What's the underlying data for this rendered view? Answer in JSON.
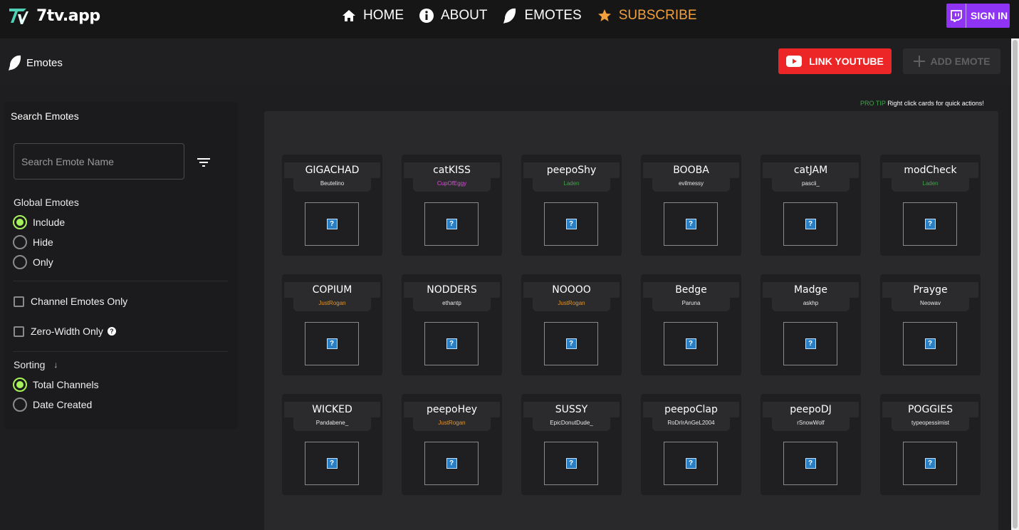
{
  "app": {
    "brand": "7tv.app",
    "accent_color": "#a5f25a"
  },
  "nav": {
    "items": [
      {
        "label": "HOME",
        "icon": "home-icon"
      },
      {
        "label": "ABOUT",
        "icon": "info-icon"
      },
      {
        "label": "EMOTES",
        "icon": "feather-icon"
      },
      {
        "label": "SUBSCRIBE",
        "icon": "star-icon",
        "color": "#f2a03d"
      }
    ],
    "sign_in": "SIGN IN"
  },
  "header": {
    "title": "Emotes",
    "link_youtube": "LINK YOUTUBE",
    "add_emote": "ADD EMOTE"
  },
  "sidebar": {
    "title": "Search Emotes",
    "search": {
      "placeholder": "Search Emote Name",
      "value": ""
    },
    "global_emotes": {
      "label": "Global Emotes",
      "options": [
        "Include",
        "Hide",
        "Only"
      ],
      "selected": "Include"
    },
    "checkboxes": [
      {
        "label": "Channel Emotes Only",
        "checked": false
      },
      {
        "label": "Zero-Width Only",
        "checked": false,
        "help": "?"
      }
    ],
    "sorting": {
      "label": "Sorting",
      "direction_icon": "↓",
      "options": [
        "Total Channels",
        "Date Created"
      ],
      "selected": "Total Channels"
    }
  },
  "main": {
    "pro_tip": {
      "tag": "PRO TIP",
      "text": "Right click cards for quick actions!"
    },
    "emotes": [
      {
        "name": "GIGACHAD",
        "owner": "Beutelino",
        "owner_color": "#e8e8e8"
      },
      {
        "name": "catKISS",
        "owner": "CupOfEggy",
        "owner_color": "#d94fd9"
      },
      {
        "name": "peepoShy",
        "owner": "Laden",
        "owner_color": "#3fa64a"
      },
      {
        "name": "BOOBA",
        "owner": "evilmessy",
        "owner_color": "#e8e8e8"
      },
      {
        "name": "catJAM",
        "owner": "pascii_",
        "owner_color": "#e8e8e8"
      },
      {
        "name": "modCheck",
        "owner": "Laden",
        "owner_color": "#3fa64a"
      },
      {
        "name": "COPIUM",
        "owner": "JustRogan",
        "owner_color": "#e0952f"
      },
      {
        "name": "NODDERS",
        "owner": "ethantp",
        "owner_color": "#e8e8e8"
      },
      {
        "name": "NOOOO",
        "owner": "JustRogan",
        "owner_color": "#e0952f"
      },
      {
        "name": "Bedge",
        "owner": "Paruna",
        "owner_color": "#e8e8e8"
      },
      {
        "name": "Madge",
        "owner": "askhp",
        "owner_color": "#e8e8e8"
      },
      {
        "name": "Prayge",
        "owner": "Neowav",
        "owner_color": "#e8e8e8"
      },
      {
        "name": "WICKED",
        "owner": "Pandabene_",
        "owner_color": "#e8e8e8"
      },
      {
        "name": "peepoHey",
        "owner": "JustRogan",
        "owner_color": "#e0952f"
      },
      {
        "name": "SUSSY",
        "owner": "EpicDonutDude_",
        "owner_color": "#e8e8e8"
      },
      {
        "name": "peepoClap",
        "owner": "RoDrIrAnGeL2004",
        "owner_color": "#e8e8e8"
      },
      {
        "name": "peepoDJ",
        "owner": "rSnowWolf",
        "owner_color": "#e8e8e8"
      },
      {
        "name": "POGGIES",
        "owner": "typeopessimist",
        "owner_color": "#e8e8e8"
      }
    ],
    "broken_image_glyph": "?"
  }
}
